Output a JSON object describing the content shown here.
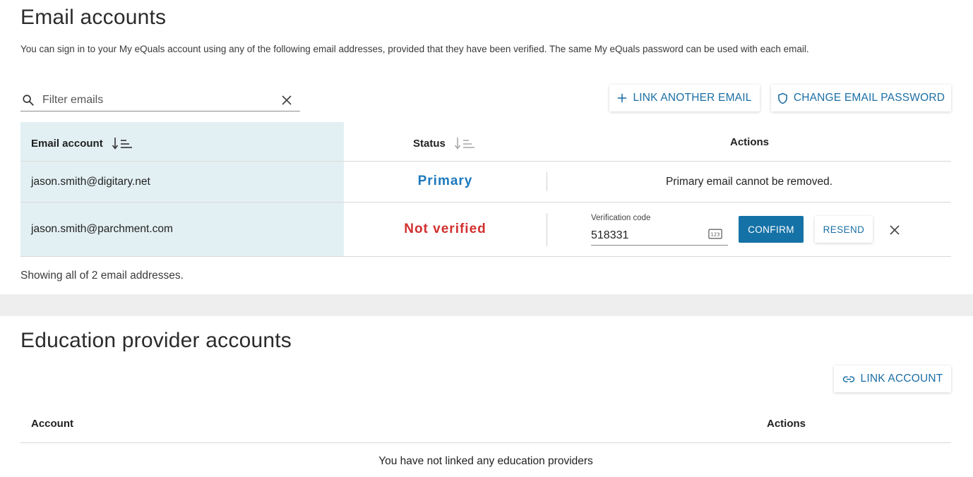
{
  "email_section": {
    "title": "Email accounts",
    "intro": "You can sign in to your My eQuals account using any of the following email addresses, provided that they have been verified. The same My eQuals password can be used with each email.",
    "filter": {
      "placeholder": "Filter emails",
      "value": ""
    },
    "buttons": {
      "link_another_email": "LINK ANOTHER EMAIL",
      "change_email_password": "CHANGE EMAIL PASSWORD"
    },
    "table": {
      "headers": {
        "email": "Email account",
        "status": "Status",
        "actions": "Actions"
      },
      "rows": [
        {
          "email": "jason.smith@digitary.net",
          "status": "Primary",
          "action_text": "Primary email cannot be removed."
        },
        {
          "email": "jason.smith@parchment.com",
          "status": "Not verified",
          "verification": {
            "label": "Verification code",
            "value": "518331"
          },
          "confirm_label": "CONFIRM",
          "resend_label": "RESEND"
        }
      ]
    },
    "showing": "Showing all of 2 email addresses."
  },
  "education_section": {
    "title": "Education provider accounts",
    "link_account": "LINK ACCOUNT",
    "table": {
      "headers": {
        "account": "Account",
        "actions": "Actions"
      },
      "empty": "You have not linked any education providers"
    }
  },
  "icons": {
    "search": "search-icon",
    "clear": "close-icon",
    "sort": "sort-icon",
    "plus": "plus-icon",
    "shield": "shield-icon",
    "link": "link-icon",
    "numeric": "numeric-keypad-icon",
    "remove": "close-icon"
  },
  "colors": {
    "accent": "#1b6fa6",
    "primary_status": "#1d79bd",
    "unverified_status": "#d32f2f",
    "confirm_bg": "#1572a6",
    "email_col_bg": "#e3f0f3"
  }
}
